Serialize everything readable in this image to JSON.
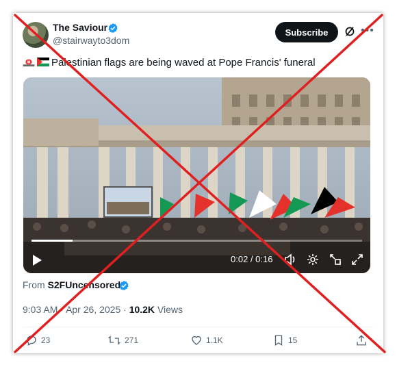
{
  "author": {
    "display_name": "The Saviour",
    "handle": "@stairwayto3dom",
    "verified_icon": "verified-badge-icon"
  },
  "header": {
    "subscribe_label": "Subscribe",
    "grok_icon": "grok-icon",
    "more_icon": "more-icon"
  },
  "tweet": {
    "text": "Palestinian flags are being waved at Pope Francis' funeral"
  },
  "video": {
    "time_display": "0:02 / 0:16",
    "progress": 0.125,
    "controls": [
      "play-icon",
      "volume-icon",
      "settings-icon",
      "picture-in-picture-icon",
      "fullscreen-icon"
    ]
  },
  "source": {
    "prefix": "From",
    "account": "S2FUncensored"
  },
  "meta": {
    "time": "9:03 AM",
    "separator1": "·",
    "date": "Apr 26, 2025",
    "separator2": "·",
    "views_count": "10.2K",
    "views_label": "Views"
  },
  "actions": {
    "replies": "23",
    "reposts": "271",
    "likes": "1.1K",
    "bookmarks": "15"
  },
  "colors": {
    "overlay_x": "#e02020",
    "verified": "#1d9bf0"
  }
}
